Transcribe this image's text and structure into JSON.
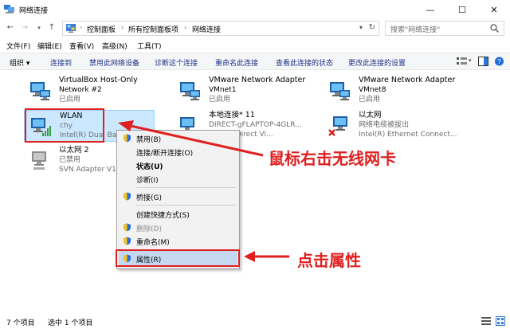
{
  "window": {
    "title": "网络连接"
  },
  "controls": {
    "minimize": "—",
    "maximize": "☐",
    "close": "✕"
  },
  "address": {
    "breadcrumbs": [
      "控制面板",
      "所有控制面板项",
      "网络连接"
    ],
    "search_placeholder": "搜索\"网络连接\""
  },
  "menu": {
    "items": [
      "文件(F)",
      "编辑(E)",
      "查看(V)",
      "高级(N)",
      "工具(T)"
    ]
  },
  "toolbar": {
    "organize": "组织 ▾",
    "commands": [
      "连接到",
      "禁用此网络设备",
      "诊断这个连接",
      "重命名此连接",
      "查看此连接的状态",
      "更改此连接的设置"
    ]
  },
  "adapters": [
    {
      "name": "VirtualBox Host-Only",
      "line2": "Network #2",
      "line3": "已启用",
      "status": "normal"
    },
    {
      "name": "VMware Network Adapter",
      "line2": "VMnet1",
      "line3": "已启用",
      "status": "normal"
    },
    {
      "name": "VMware Network Adapter",
      "line2": "VMnet8",
      "line3": "已启用",
      "status": "normal"
    },
    {
      "name": "WLAN",
      "line2": "chy",
      "line3": "Intel(R) Dual Band",
      "status": "wireless"
    },
    {
      "name": "本地连接* 11",
      "line2": "DIRECT-gFLAPTOP-4GLR...",
      "line3": "ft Wi-Fi Direct Vi...",
      "status": "normal"
    },
    {
      "name": "以太网",
      "line2": "网络电缆被拔出",
      "line3": "Intel(R) Ethernet Connect...",
      "status": "disconnected"
    },
    {
      "name": "以太网 2",
      "line2": "已禁用",
      "line3": "SVN Adapter V1",
      "status": "disabled"
    }
  ],
  "context_menu": {
    "items": [
      {
        "label": "禁用(B)",
        "shield": true,
        "bold": false,
        "disabled": false
      },
      {
        "label": "连接/断开连接(O)",
        "shield": false,
        "bold": false,
        "disabled": false
      },
      {
        "label": "状态(U)",
        "shield": false,
        "bold": true,
        "disabled": false
      },
      {
        "label": "诊断(I)",
        "shield": false,
        "bold": false,
        "disabled": false
      },
      {
        "label": "桥接(G)",
        "shield": true,
        "bold": false,
        "disabled": false
      },
      {
        "label": "创建快捷方式(S)",
        "shield": false,
        "bold": false,
        "disabled": false
      },
      {
        "label": "删除(D)",
        "shield": true,
        "bold": false,
        "disabled": true
      },
      {
        "label": "重命名(M)",
        "shield": true,
        "bold": false,
        "disabled": false
      },
      {
        "label": "属性(R)",
        "shield": true,
        "bold": false,
        "disabled": false,
        "highlighted": true
      }
    ]
  },
  "annotations": {
    "right_click": "鼠标右击无线网卡",
    "click_properties": "点击属性",
    "color": "#e02020"
  },
  "statusbar": {
    "item_count": "7 个项目",
    "selected": "选中 1 个项目"
  },
  "colors": {
    "selection": "#cce8ff",
    "link": "#1e3287",
    "menu_highlight": "#c4d8ef"
  }
}
